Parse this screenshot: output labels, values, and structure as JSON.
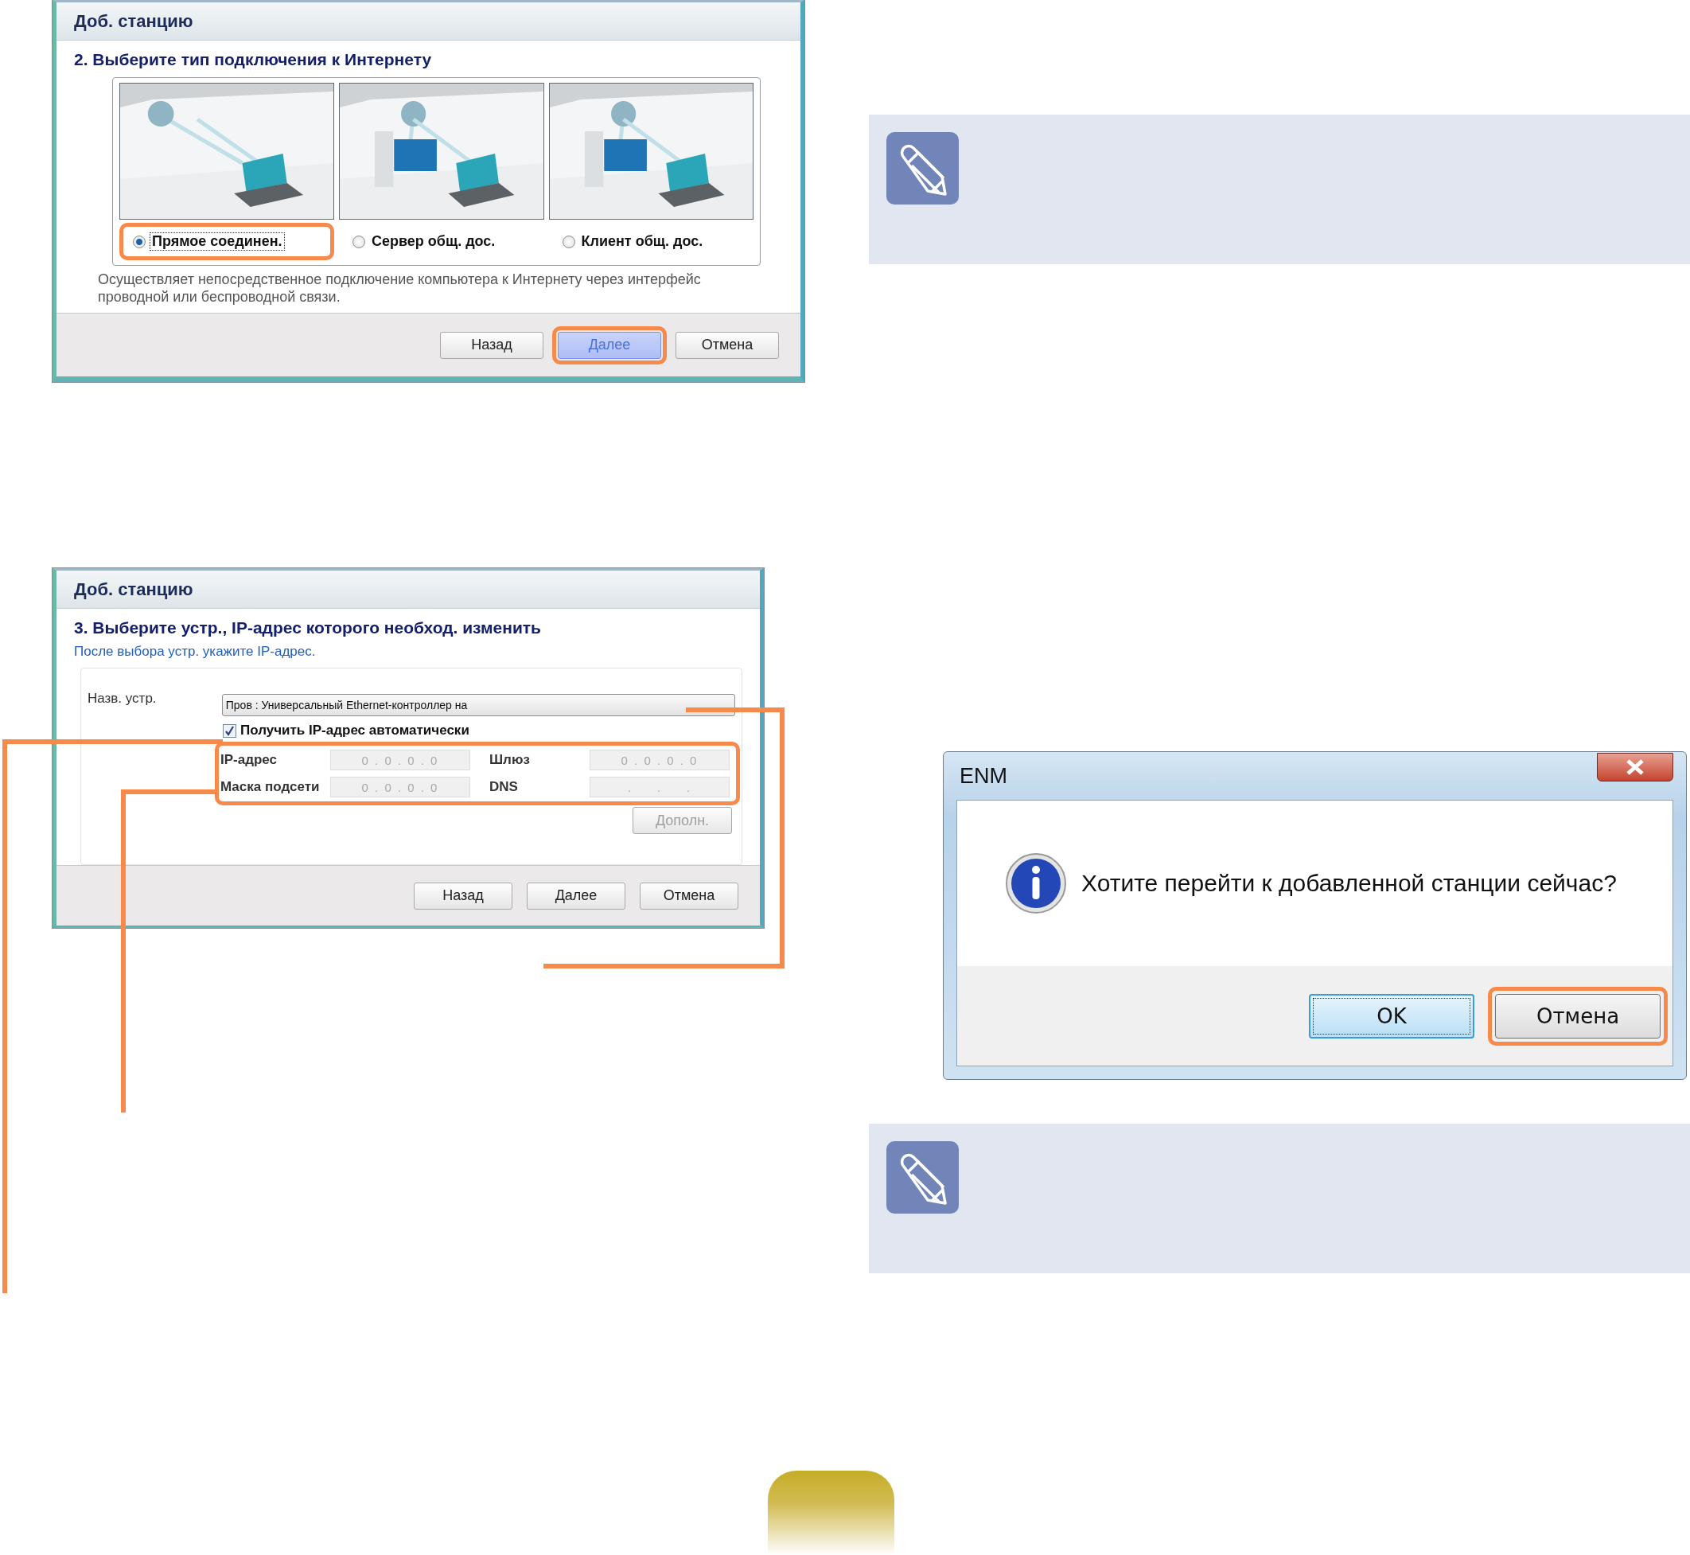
{
  "wizard_type": {
    "title": "Доб. станцию",
    "heading": "2. Выберите тип подключения к Интернету",
    "options": [
      {
        "label": "Прямое соединен.",
        "selected": true,
        "highlighted": true
      },
      {
        "label": "Сервер общ. дос.",
        "selected": false,
        "highlighted": false
      },
      {
        "label": "Клиент общ. дос.",
        "selected": false,
        "highlighted": false
      }
    ],
    "description": "Осуществляет непосредственное подключение компьютера к Интернету через интерфейс проводной или беспроводной связи.",
    "buttons": [
      {
        "label": "Назад",
        "focused": false,
        "highlighted": false
      },
      {
        "label": "Далее",
        "focused": true,
        "highlighted": true
      },
      {
        "label": "Отмена",
        "focused": false,
        "highlighted": false
      }
    ]
  },
  "wizard_ip": {
    "title": "Доб. станцию",
    "heading": "3. Выберите устр., IP-адрес которого необход. изменить",
    "subheading": "После выбора устр. укажите IP-адрес.",
    "device_label": "Назв. устр.",
    "device_value": "Пров : Универсальный Ethernet-контроллер на",
    "auto_ip": {
      "label": "Получить IP-адрес автоматически",
      "checked": true
    },
    "fields_highlighted": true,
    "fields": [
      {
        "label": "IP-адрес",
        "value": "0 . 0 . 0 . 0",
        "disabled": true
      },
      {
        "label": "Шлюз",
        "value": "0 . 0 . 0 . 0",
        "disabled": true
      },
      {
        "label": "Маска подсети",
        "value": "0 . 0 . 0 . 0",
        "disabled": true
      },
      {
        "label": "DNS",
        "value": ".     .     .",
        "disabled": true
      }
    ],
    "advanced": {
      "label": "Дополн.",
      "disabled": true
    },
    "buttons": [
      {
        "label": "Назад",
        "focused": false,
        "highlighted": false
      },
      {
        "label": "Далее",
        "focused": false,
        "highlighted": false
      },
      {
        "label": "Отмена",
        "focused": false,
        "highlighted": false
      }
    ]
  },
  "message_box": {
    "title": "ENM",
    "message": "Хотите перейти к добавленной станции сейчас?",
    "buttons": [
      {
        "label": "OK",
        "focused": true,
        "highlighted": false
      },
      {
        "label": "Отмена",
        "focused": false,
        "highlighted": true
      }
    ]
  },
  "notes": [
    {
      "kind": "note"
    },
    {
      "kind": "note"
    }
  ]
}
